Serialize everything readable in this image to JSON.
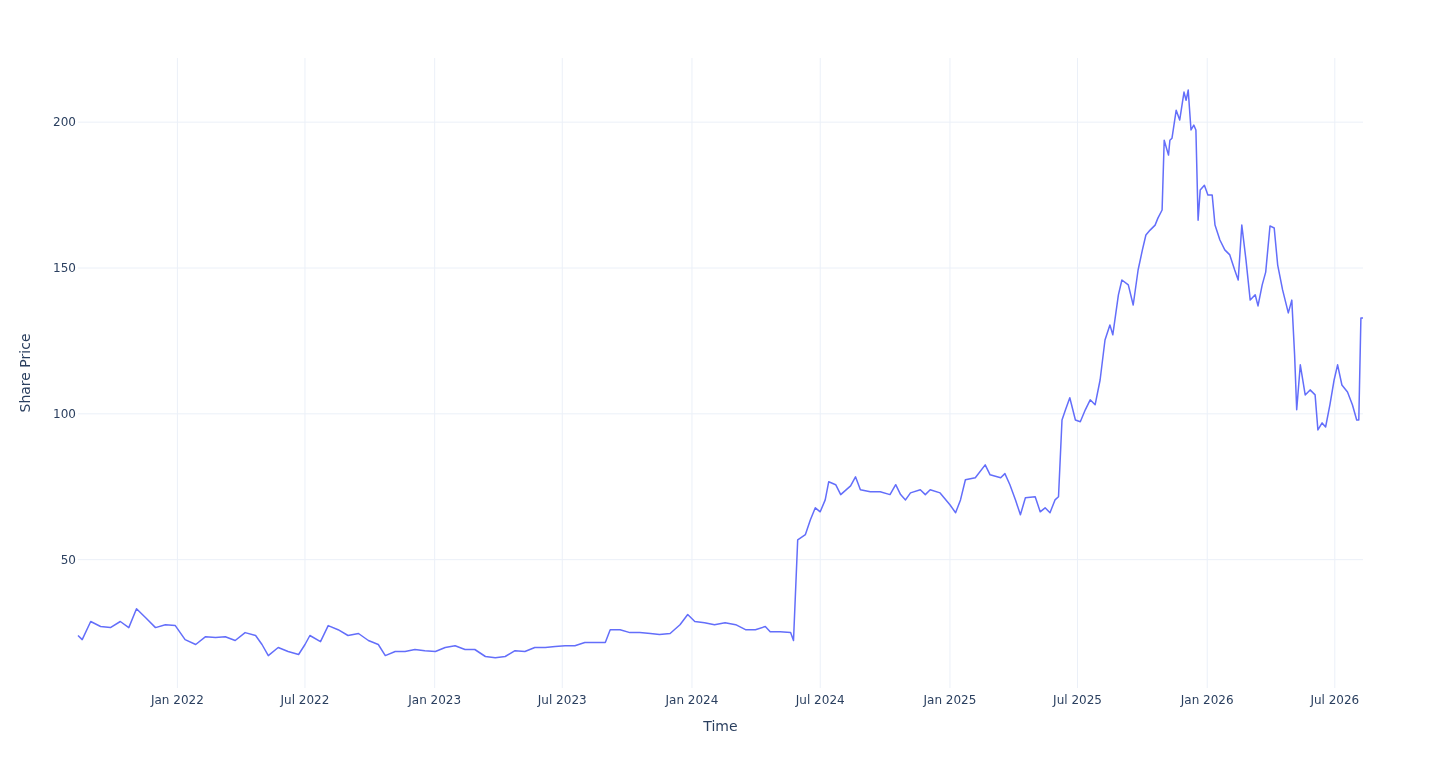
{
  "chart": {
    "chart_data": {
      "type": "line",
      "xlabel": "Time",
      "ylabel": "Share Price",
      "grid": true,
      "xlim": [
        "2021-08-13",
        "2026-08-10"
      ],
      "ylim": [
        6,
        222
      ],
      "xticks": [
        {
          "value": "2022-01-01",
          "label": "Jan 2022"
        },
        {
          "value": "2022-07-01",
          "label": "Jul 2022"
        },
        {
          "value": "2023-01-01",
          "label": "Jan 2023"
        },
        {
          "value": "2023-07-01",
          "label": "Jul 2023"
        },
        {
          "value": "2024-01-01",
          "label": "Jan 2024"
        },
        {
          "value": "2024-07-01",
          "label": "Jul 2024"
        },
        {
          "value": "2025-01-01",
          "label": "Jan 2025"
        },
        {
          "value": "2025-07-01",
          "label": "Jul 2025"
        },
        {
          "value": "2026-01-01",
          "label": "Jan 2026"
        },
        {
          "value": "2026-07-01",
          "label": "Jul 2026"
        }
      ],
      "yticks": [
        50,
        100,
        150,
        200
      ],
      "x": [
        "2021-08-13",
        "2021-08-19",
        "2021-08-31",
        "2021-09-14",
        "2021-09-28",
        "2021-10-12",
        "2021-10-24",
        "2021-11-04",
        "2021-11-17",
        "2021-12-01",
        "2021-12-15",
        "2021-12-29",
        "2022-01-12",
        "2022-01-27",
        "2022-02-10",
        "2022-02-24",
        "2022-03-10",
        "2022-03-24",
        "2022-04-07",
        "2022-04-22",
        "2022-05-01",
        "2022-05-10",
        "2022-05-24",
        "2022-06-07",
        "2022-06-22",
        "2022-07-01",
        "2022-07-08",
        "2022-07-23",
        "2022-08-03",
        "2022-08-17",
        "2022-08-31",
        "2022-09-15",
        "2022-09-29",
        "2022-10-13",
        "2022-10-23",
        "2022-11-06",
        "2022-11-20",
        "2022-12-04",
        "2022-12-18",
        "2023-01-02",
        "2023-01-16",
        "2023-01-30",
        "2023-02-13",
        "2023-02-27",
        "2023-03-14",
        "2023-03-28",
        "2023-04-11",
        "2023-04-25",
        "2023-05-09",
        "2023-05-23",
        "2023-06-07",
        "2023-06-21",
        "2023-07-05",
        "2023-07-19",
        "2023-08-02",
        "2023-08-16",
        "2023-08-31",
        "2023-09-07",
        "2023-09-21",
        "2023-10-05",
        "2023-10-19",
        "2023-11-03",
        "2023-11-16",
        "2023-12-01",
        "2023-12-15",
        "2023-12-26",
        "2024-01-05",
        "2024-01-19",
        "2024-02-02",
        "2024-02-17",
        "2024-03-03",
        "2024-03-17",
        "2024-03-31",
        "2024-04-14",
        "2024-04-21",
        "2024-05-05",
        "2024-05-20",
        "2024-05-24",
        "2024-05-30",
        "2024-06-10",
        "2024-06-17",
        "2024-06-24",
        "2024-07-01",
        "2024-07-08",
        "2024-07-13",
        "2024-07-23",
        "2024-07-30",
        "2024-08-13",
        "2024-08-20",
        "2024-08-27",
        "2024-09-10",
        "2024-09-24",
        "2024-10-08",
        "2024-10-16",
        "2024-10-23",
        "2024-10-30",
        "2024-11-06",
        "2024-11-20",
        "2024-11-27",
        "2024-12-04",
        "2024-12-18",
        "2025-01-01",
        "2025-01-09",
        "2025-01-16",
        "2025-01-23",
        "2025-02-06",
        "2025-02-20",
        "2025-02-27",
        "2025-03-14",
        "2025-03-20",
        "2025-03-27",
        "2025-04-04",
        "2025-04-11",
        "2025-04-18",
        "2025-05-02",
        "2025-05-09",
        "2025-05-16",
        "2025-05-23",
        "2025-05-30",
        "2025-06-04",
        "2025-06-09",
        "2025-06-14",
        "2025-06-20",
        "2025-06-28",
        "2025-07-05",
        "2025-07-12",
        "2025-07-19",
        "2025-07-26",
        "2025-08-02",
        "2025-08-09",
        "2025-08-16",
        "2025-08-20",
        "2025-08-28",
        "2025-09-02",
        "2025-09-11",
        "2025-09-18",
        "2025-09-25",
        "2025-10-01",
        "2025-10-06",
        "2025-10-12",
        "2025-10-19",
        "2025-10-23",
        "2025-10-29",
        "2025-11-01",
        "2025-11-07",
        "2025-11-09",
        "2025-11-12",
        "2025-11-18",
        "2025-11-23",
        "2025-11-29",
        "2025-12-02",
        "2025-12-05",
        "2025-12-09",
        "2025-12-13",
        "2025-12-16",
        "2025-12-19",
        "2025-12-22",
        "2025-12-28",
        "2026-01-02",
        "2026-01-08",
        "2026-01-12",
        "2026-01-19",
        "2026-01-26",
        "2026-02-02",
        "2026-02-09",
        "2026-02-14",
        "2026-02-19",
        "2026-02-25",
        "2026-03-03",
        "2026-03-10",
        "2026-03-14",
        "2026-03-20",
        "2026-03-25",
        "2026-03-31",
        "2026-04-06",
        "2026-04-11",
        "2026-04-18",
        "2026-04-26",
        "2026-05-01",
        "2026-05-05",
        "2026-05-08",
        "2026-05-13",
        "2026-05-20",
        "2026-05-27",
        "2026-06-03",
        "2026-06-07",
        "2026-06-13",
        "2026-06-18",
        "2026-06-24",
        "2026-06-30",
        "2026-07-05",
        "2026-07-11",
        "2026-07-19",
        "2026-07-26",
        "2026-08-01",
        "2026-08-04",
        "2026-08-07",
        "2026-08-10"
      ],
      "series": [
        {
          "color": "#636efa",
          "values": [
            24.0,
            22.6,
            28.8,
            27.1,
            26.7,
            28.8,
            26.7,
            33.2,
            30.1,
            26.7,
            27.7,
            27.4,
            22.6,
            20.9,
            23.6,
            23.3,
            23.6,
            22.3,
            25.0,
            24.0,
            20.9,
            17.1,
            19.9,
            18.5,
            17.5,
            20.9,
            24.0,
            21.9,
            27.4,
            26.0,
            24.0,
            24.7,
            22.3,
            20.9,
            17.1,
            18.5,
            18.5,
            19.2,
            18.8,
            18.5,
            19.9,
            20.5,
            19.2,
            19.2,
            16.8,
            16.4,
            16.8,
            18.8,
            18.5,
            19.9,
            19.9,
            20.2,
            20.5,
            20.5,
            21.6,
            21.6,
            21.6,
            26.0,
            26.0,
            25.0,
            25.0,
            24.7,
            24.3,
            24.7,
            27.7,
            31.2,
            28.8,
            28.4,
            27.7,
            28.4,
            27.7,
            26.0,
            26.0,
            27.1,
            25.3,
            25.3,
            25.0,
            22.3,
            56.8,
            58.6,
            63.7,
            67.8,
            66.4,
            70.5,
            76.7,
            75.7,
            72.3,
            75.3,
            78.4,
            74.0,
            73.3,
            73.3,
            72.3,
            75.7,
            72.3,
            70.5,
            72.9,
            74.0,
            72.3,
            74.0,
            72.9,
            68.8,
            66.1,
            70.5,
            77.4,
            78.1,
            82.5,
            79.1,
            78.1,
            79.5,
            75.7,
            70.5,
            65.4,
            71.2,
            71.6,
            66.4,
            67.8,
            66.1,
            70.5,
            71.6,
            97.9,
            101.4,
            105.5,
            97.9,
            97.3,
            101.4,
            104.8,
            103.1,
            111.6,
            125.3,
            130.5,
            127.1,
            140.8,
            145.9,
            144.2,
            137.3,
            149.3,
            156.2,
            161.3,
            163.0,
            164.7,
            167.1,
            169.9,
            193.8,
            188.7,
            193.8,
            194.5,
            204.1,
            200.7,
            210.3,
            207.5,
            211.0,
            197.3,
            199.0,
            197.3,
            166.4,
            176.7,
            178.4,
            175.0,
            175.0,
            164.7,
            159.6,
            156.2,
            154.5,
            149.3,
            145.9,
            164.7,
            152.7,
            139.0,
            140.8,
            137.0,
            144.2,
            148.6,
            164.4,
            163.7,
            151.0,
            142.5,
            134.6,
            139.0,
            120.2,
            101.4,
            116.8,
            106.5,
            108.2,
            106.5,
            94.5,
            96.9,
            95.5,
            103.1,
            111.6,
            116.8,
            109.9,
            107.5,
            103.1,
            97.9,
            97.9,
            132.9,
            132.9
          ]
        }
      ]
    }
  }
}
